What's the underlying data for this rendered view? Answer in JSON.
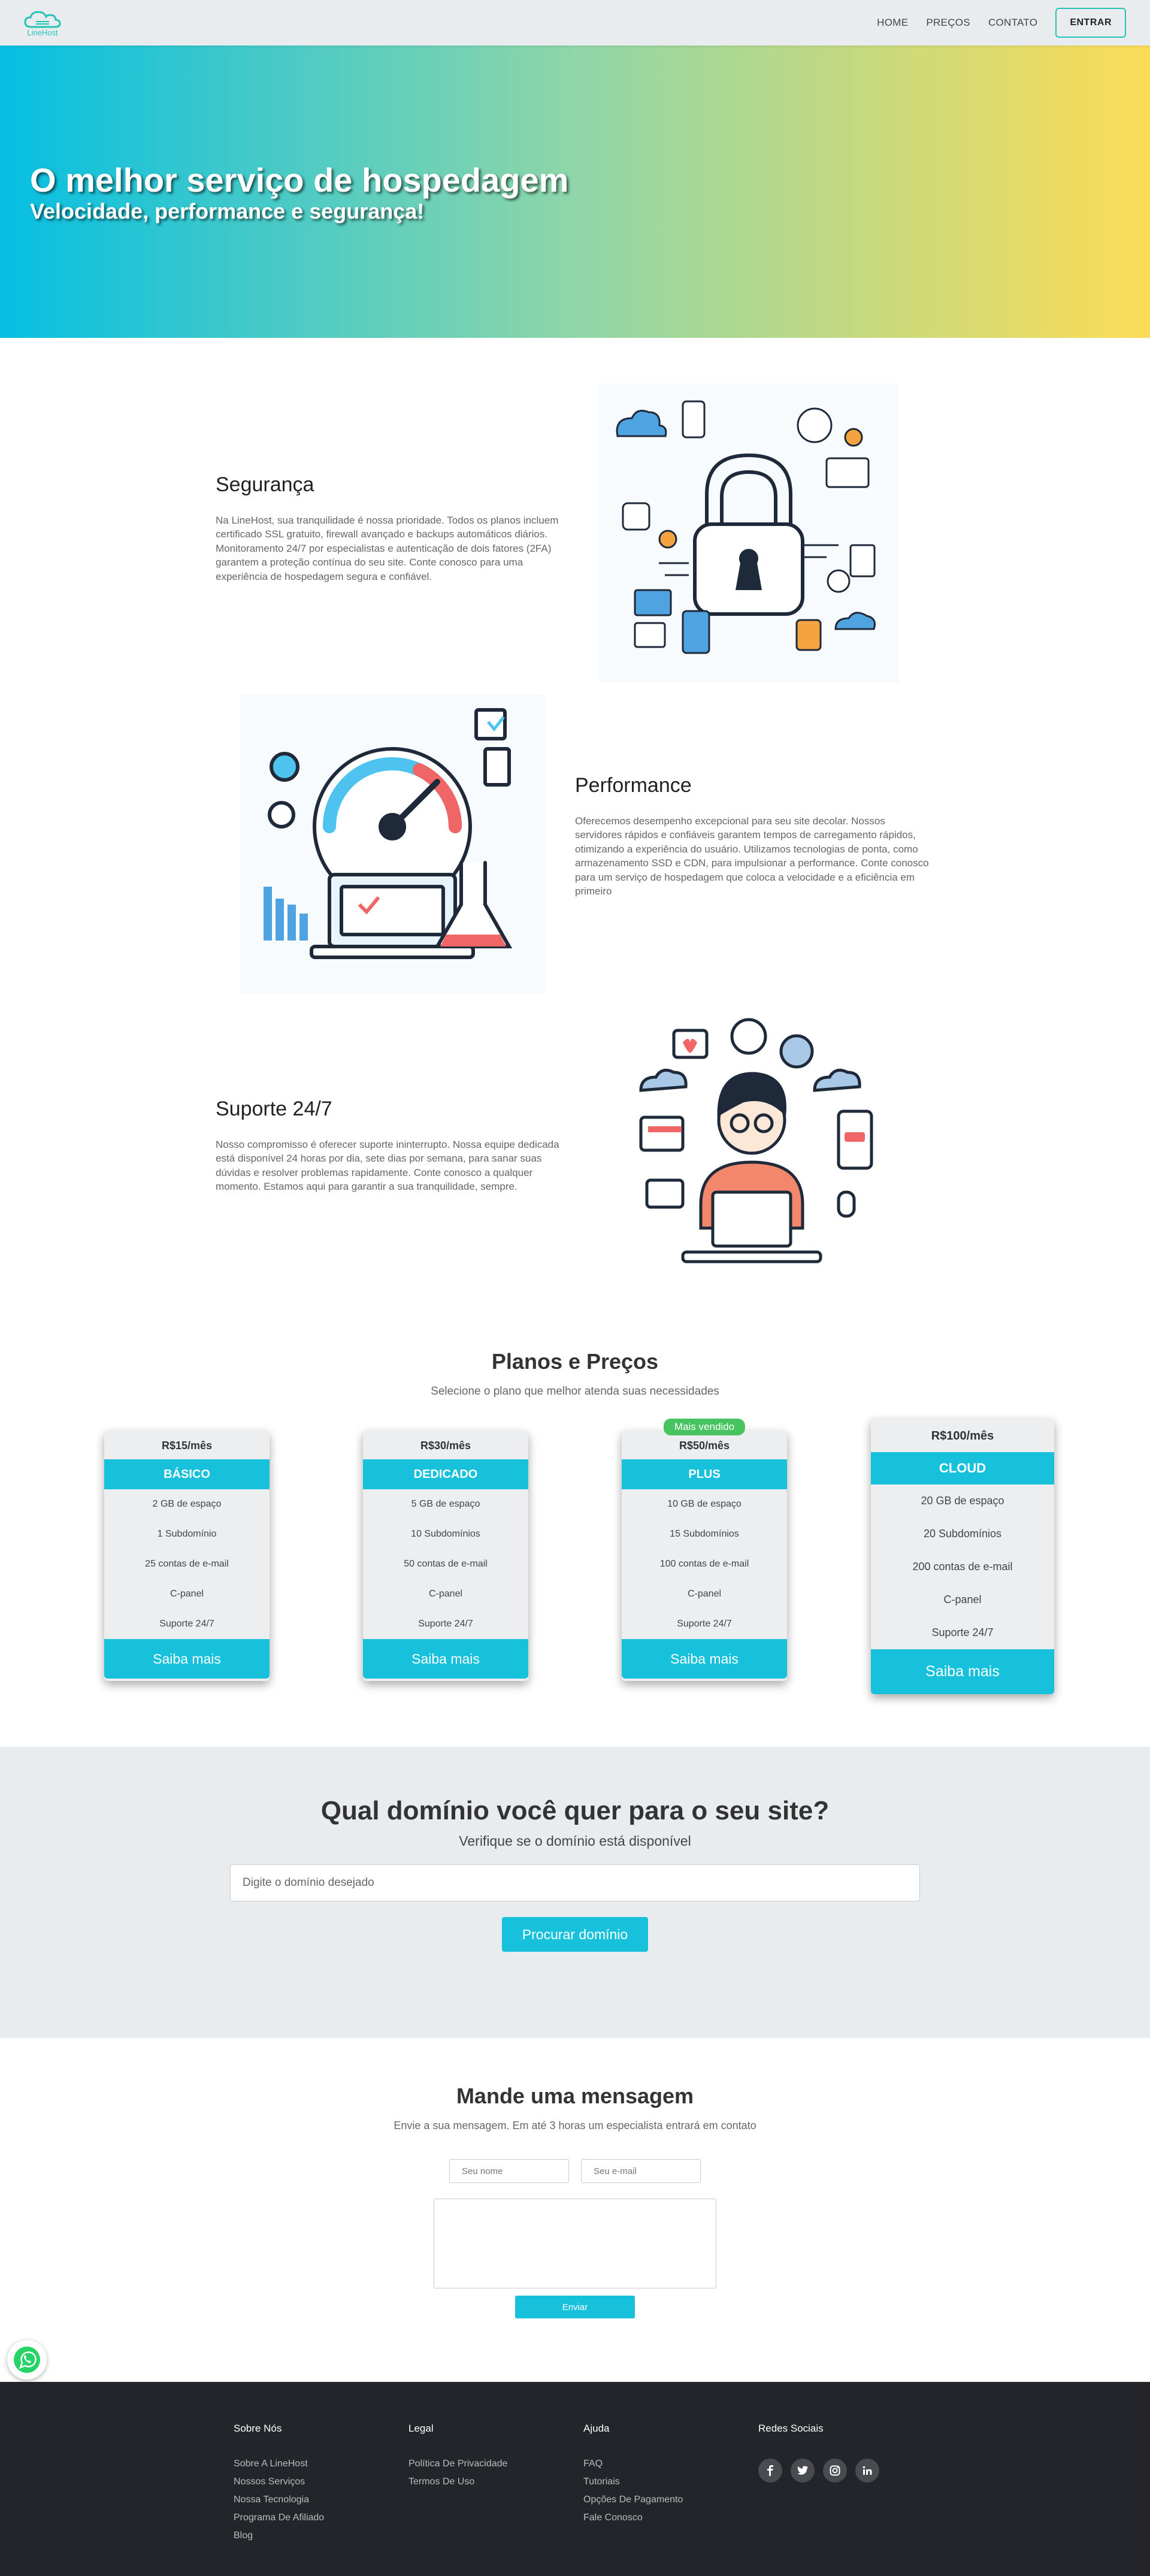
{
  "nav": {
    "logo_text": "LineHost",
    "links": [
      "HOME",
      "PREÇOS",
      "CONTATO"
    ],
    "login_label": "ENTRAR"
  },
  "hero": {
    "title": "O melhor serviço de hospedagem",
    "subtitle": "Velocidade, performance e segurança!"
  },
  "features": [
    {
      "title": "Segurança",
      "description": "Na LineHost, sua tranquilidade é nossa prioridade. Todos os planos incluem certificado SSL gratuito, firewall avançado e backups automáticos diários. Monitoramento 24/7 por especialistas e autenticação de dois fatores (2FA) garantem a proteção contínua do seu site. Conte conosco para uma experiência de hospedagem segura e confiável."
    },
    {
      "title": "Performance",
      "description": "Oferecemos desempenho excepcional para seu site decolar. Nossos servidores rápidos e confiáveis garantem tempos de carregamento rápidos, otimizando a experiência do usuário. Utilizamos tecnologias de ponta, como armazenamento SSD e CDN, para impulsionar a performance. Conte conosco para um serviço de hospedagem que coloca a velocidade e a eficiência em primeiro"
    },
    {
      "title": "Suporte 24/7",
      "description": "Nosso compromisso é oferecer suporte ininterrupto. Nossa equipe dedicada está disponível 24 horas por dia, sete dias por semana, para sanar suas dúvidas e resolver problemas rapidamente. Conte conosco a qualquer momento. Estamos aqui para garantir a sua tranquilidade, sempre."
    }
  ],
  "pricing": {
    "title": "Planos e Preços",
    "subtitle": "Selecione o plano que melhor atenda suas necessidades",
    "cta_label": "Saiba mais",
    "plans": [
      {
        "price": "R$15/mês",
        "name": "BÁSICO",
        "features": [
          "2 GB de espaço",
          "1 Subdomínio",
          "25 contas de e-mail",
          "C-panel",
          "Suporte 24/7"
        ]
      },
      {
        "price": "R$30/mês",
        "name": "DEDICADO",
        "features": [
          "5 GB de espaço",
          "10 Subdomínios",
          "50 contas de e-mail",
          "C-panel",
          "Suporte 24/7"
        ]
      },
      {
        "price": "R$50/mês",
        "name": "PLUS",
        "badge": "Mais vendido",
        "features": [
          "10 GB de espaço",
          "15 Subdomínios",
          "100 contas de e-mail",
          "C-panel",
          "Suporte 24/7"
        ]
      },
      {
        "price": "R$100/mês",
        "name": "CLOUD",
        "features": [
          "20 GB de espaço",
          "20 Subdomínios",
          "200 contas de e-mail",
          "C-panel",
          "Suporte 24/7"
        ]
      }
    ]
  },
  "domain": {
    "title": "Qual domínio você quer para o seu site?",
    "subtitle": "Verifique se o domínio está disponível",
    "placeholder": "Digite o domínio desejado",
    "button": "Procurar domínio"
  },
  "contact": {
    "title": "Mande uma mensagem",
    "subtitle": "Envie a sua mensagem. Em até 3 horas um especialista entrará em contato",
    "name_placeholder": "Seu nome",
    "email_placeholder": "Seu e-mail",
    "button": "Enviar"
  },
  "footer": {
    "columns": [
      {
        "title": "Sobre Nós",
        "links": [
          "Sobre A LineHost",
          "Nossos Serviços",
          "Nossa Tecnologia",
          "Programa De Afiliado",
          "Blog"
        ]
      },
      {
        "title": "Legal",
        "links": [
          "Política De Privacidade",
          "Termos De Uso"
        ]
      },
      {
        "title": "Ajuda",
        "links": [
          "FAQ",
          "Tutoriais",
          "Opções De Pagamento",
          "Fale Conosco"
        ]
      },
      {
        "title": "Redes Sociais",
        "icons": [
          "facebook-icon",
          "twitter-icon",
          "instagram-icon",
          "linkedin-icon"
        ]
      }
    ]
  },
  "colors": {
    "accent": "#17c1dc",
    "badge": "#47c45f",
    "hero_start": "#06bfe2",
    "hero_end": "#fcdc56",
    "footer_bg": "#24252a"
  }
}
